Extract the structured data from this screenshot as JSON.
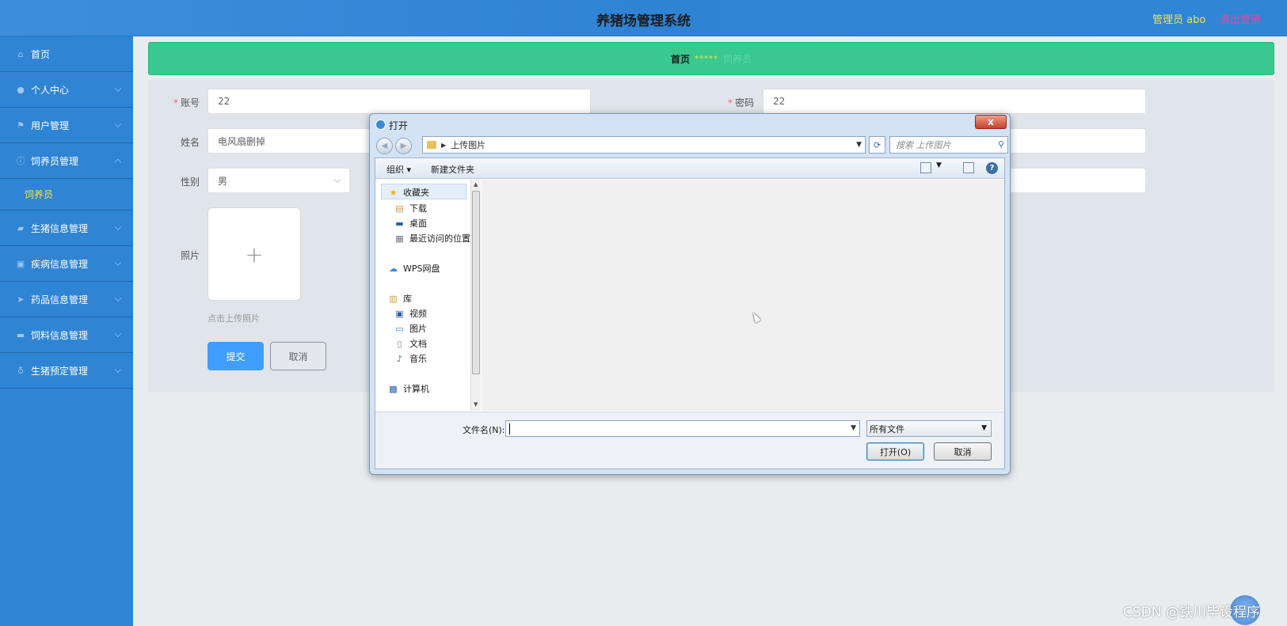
{
  "header": {
    "title": "养猪场管理系统",
    "user": "管理员 abo",
    "logout": "退出登录"
  },
  "sidebar": {
    "items": [
      {
        "label": "首页",
        "icon": "home-icon"
      },
      {
        "label": "个人中心",
        "icon": "user-icon"
      },
      {
        "label": "用户管理",
        "icon": "flag-icon"
      },
      {
        "label": "饲养员管理",
        "icon": "info-icon"
      },
      {
        "label": "生猪信息管理",
        "icon": "briefcase-icon"
      },
      {
        "label": "疾病信息管理",
        "icon": "medkit-icon"
      },
      {
        "label": "药品信息管理",
        "icon": "send-icon"
      },
      {
        "label": "饲料信息管理",
        "icon": "monitor-icon"
      },
      {
        "label": "生猪预定管理",
        "icon": "mic-icon"
      }
    ],
    "sub_item": "饲养员"
  },
  "breadcrumb": {
    "home": "首页",
    "separator": "*****",
    "current": "饲养员"
  },
  "form": {
    "account_label": "账号",
    "account_value": "22",
    "password_label": "密码",
    "password_value": "22",
    "name_label": "姓名",
    "name_value": "电风扇删掉",
    "gender_label": "性别",
    "gender_value": "男",
    "photo_label": "照片",
    "upload_plus": "+",
    "upload_hint": "点击上传照片",
    "submit": "提交",
    "cancel": "取消"
  },
  "dialog": {
    "title": "打开",
    "close": "x",
    "address": "上传图片",
    "search_placeholder": "搜索 上传图片",
    "toolbar": {
      "organize": "组织 ▾",
      "new_folder": "新建文件夹",
      "help": "?"
    },
    "tree": {
      "favorites": "收藏夹",
      "downloads": "下载",
      "desktop": "桌面",
      "recent": "最近访问的位置",
      "wps": "WPS网盘",
      "library": "库",
      "videos": "视频",
      "pictures": "图片",
      "documents": "文档",
      "music": "音乐",
      "computer": "计算机"
    },
    "filename_label": "文件名(N):",
    "filetype": "所有文件",
    "open_button": "打开(O)",
    "cancel_button": "取消"
  },
  "watermark": "CSDN @铁川毕设程序"
}
